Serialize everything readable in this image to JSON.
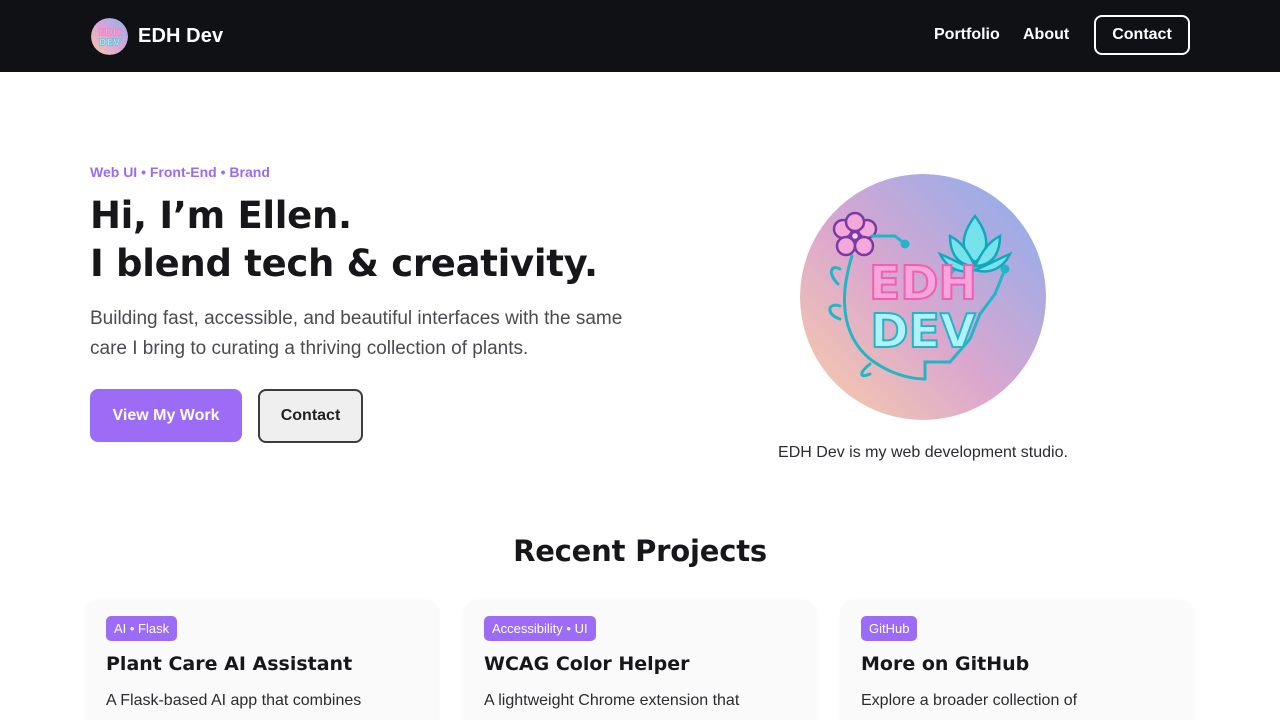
{
  "header": {
    "brand_name": "EDH Dev",
    "brand_logo_icon": "edh-dev-logo",
    "nav": {
      "portfolio": "Portfolio",
      "about": "About",
      "contact": "Contact"
    }
  },
  "hero": {
    "eyebrow": "Web UI • Front-End • Brand",
    "title_line1": "Hi, I’m Ellen.",
    "title_line2": "I blend tech & creativity.",
    "subtitle": "Building fast, accessible, and beautiful interfaces with the same care I bring to curating a thriving collection of plants.",
    "primary_button": "View My Work",
    "secondary_button": "Contact",
    "logo_text_line1": "EDH",
    "logo_text_line2": "DEV",
    "logo_caption": "EDH Dev is my web development studio."
  },
  "projects": {
    "title": "Recent Projects",
    "items": [
      {
        "tag": "AI • Flask",
        "title": "Plant Care AI Assistant",
        "description": "A Flask-based AI app that combines"
      },
      {
        "tag": "Accessibility • UI",
        "title": "WCAG Color Helper",
        "description": "A lightweight Chrome extension that"
      },
      {
        "tag": "GitHub",
        "title": "More on GitHub",
        "description": "Explore a broader collection of"
      }
    ]
  },
  "colors": {
    "nav_bg": "#0f1115",
    "accent": "#9d6cf6",
    "text": "#17171b"
  }
}
